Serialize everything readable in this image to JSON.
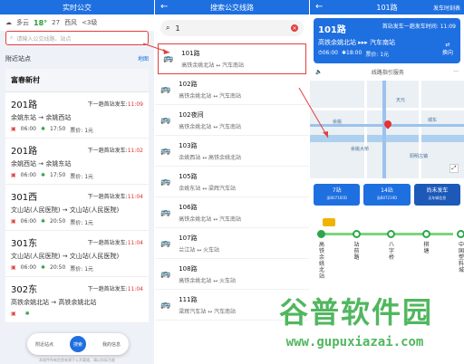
{
  "p1": {
    "title": "实时公交",
    "weather": {
      "city": "多云",
      "temp": "18°",
      "aqi": "27",
      "wind": "西风",
      "level": "<3级"
    },
    "search_placeholder": "请输入公交线路、站点",
    "nearby_title": "附近站点",
    "nearby_more": "地图",
    "station": "富春新村",
    "routes": [
      {
        "name": "201路",
        "next_label": "下一趟首站发车:",
        "next_time": "11:09",
        "dir": "余姚东站 → 余姚西站",
        "start": "06:00",
        "end": "17:50",
        "fare": "票价: 1元"
      },
      {
        "name": "201路",
        "next_label": "下一趟首站发车:",
        "next_time": "11:02",
        "dir": "余姚西站 → 余姚东站",
        "start": "06:00",
        "end": "17:50",
        "fare": "票价: 1元"
      },
      {
        "name": "301西",
        "next_label": "下一趟首站发车:",
        "next_time": "11:04",
        "dir": "文山站(人民医院) → 文山站(人民医院)",
        "start": "06:00",
        "end": "20:50",
        "fare": "票价: 1元"
      },
      {
        "name": "301东",
        "next_label": "下一趟首站发车:",
        "next_time": "11:04",
        "dir": "文山站(人民医院) → 文山站(人民医院)",
        "start": "06:00",
        "end": "20:50",
        "fare": "票价: 1元"
      },
      {
        "name": "302东",
        "next_label": "下一趟首站发车:",
        "next_time": "11:04",
        "dir": "高铁余姚北站 → 高铁余姚北站",
        "start": "",
        "end": "",
        "fare": ""
      }
    ],
    "nav": {
      "left": "附近站点",
      "center": "搜索",
      "right": "我的信息"
    },
    "footer": "本软件所有信息来源于公开渠道，请以实际为准"
  },
  "p2": {
    "title": "搜索公交线路",
    "query": "1",
    "results": [
      {
        "name": "101路",
        "dir": "高铁余姚北站 ↔ 汽车南站"
      },
      {
        "name": "102路",
        "dir": "高铁余姚北站 ↔ 汽车南站"
      },
      {
        "name": "102夜间",
        "dir": "高铁余姚北站 ↔ 汽车南站"
      },
      {
        "name": "103路",
        "dir": "余姚西站 ↔ 高铁余姚北站"
      },
      {
        "name": "105路",
        "dir": "余姚东站 ↔ 梁辉汽车站"
      },
      {
        "name": "106路",
        "dir": "高铁余姚北站 ↔ 汽车南站"
      },
      {
        "name": "107路",
        "dir": "兰江站 ↔ 火车站"
      },
      {
        "name": "108路",
        "dir": "高铁余姚北站 ↔ 火车站"
      },
      {
        "name": "111路",
        "dir": "梁辉汽车站 ↔ 汽车南站"
      }
    ]
  },
  "p3": {
    "title": "101路",
    "timetable": "发车时刻表",
    "route": "101路",
    "next_first": "首站发车一趟发车时间:",
    "next_time": "11:09",
    "dir_from": "高铁余姚北站",
    "dir_to": "汽车南站",
    "start": "06:00",
    "end": "18:00",
    "fare": "票价: 1元",
    "swap": "换向",
    "guide": "线路指引服务",
    "eta": [
      {
        "main": "7站",
        "sub": "浙B07160D"
      },
      {
        "main": "14站",
        "sub": "浙B07219D"
      },
      {
        "main": "尚未发车",
        "sub": "无车辆信息"
      }
    ],
    "stops": [
      "高铁余姚北站",
      "站前路",
      "八字桥",
      "棋塘",
      "中国塑料城"
    ],
    "map_labels": [
      "余姚",
      "天元",
      "余姚大桥",
      "阳明古镇",
      "城东"
    ]
  },
  "watermark": {
    "text": "谷普软件园",
    "url": "www.gupuxiazai.com"
  },
  "colors": {
    "accent": "#1e6fe0",
    "alert": "#e03030",
    "green": "#2ea64a"
  }
}
